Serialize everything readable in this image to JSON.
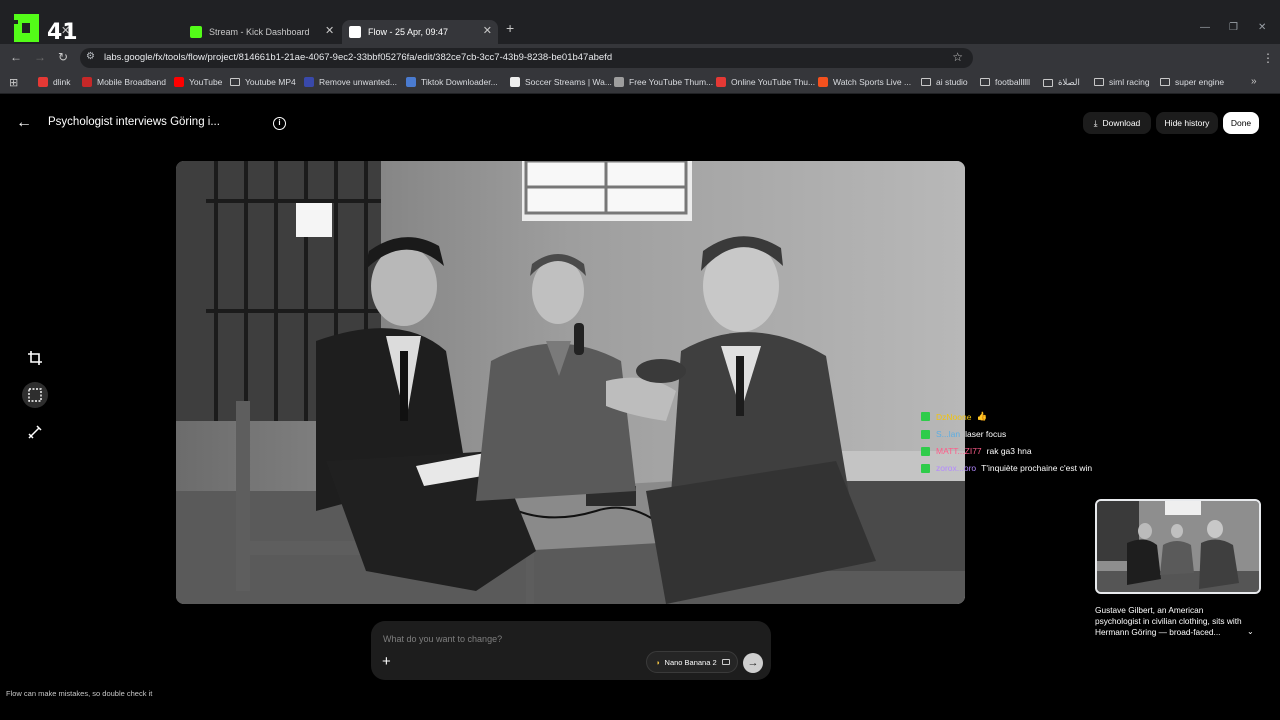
{
  "browser": {
    "logo_text": "41",
    "tabs": [
      {
        "label": "Stream - Kick Dashboard",
        "fav_color": "#53fc18"
      },
      {
        "label": "Flow - 25 Apr, 09:47",
        "fav_color": "#ffffff"
      }
    ],
    "url": "labs.google/fx/tools/flow/project/814661b1-21ae-4067-9ec2-33bbf05276fa/edit/382ce7cb-3cc7-43b9-8238-be01b47abefd",
    "bookmarks": [
      {
        "label": "dlink",
        "type": "site",
        "color": "#e53935"
      },
      {
        "label": "Mobile Broadband",
        "type": "site",
        "color": "#c62828"
      },
      {
        "label": "YouTube",
        "type": "site",
        "color": "#ff0000"
      },
      {
        "label": "Youtube MP4",
        "type": "folder"
      },
      {
        "label": "Remove unwanted...",
        "type": "site",
        "color": "#3949ab"
      },
      {
        "label": "Tiktok Downloader...",
        "type": "site",
        "color": "#4a7bd0"
      },
      {
        "label": "Soccer Streams | Wa...",
        "type": "site",
        "color": "#eeeeee"
      },
      {
        "label": "Free YouTube Thum...",
        "type": "site",
        "color": "#9e9e9e"
      },
      {
        "label": "Online YouTube Thu...",
        "type": "site",
        "color": "#e53935"
      },
      {
        "label": "Watch Sports Live ...",
        "type": "site",
        "color": "#f4511e"
      },
      {
        "label": "ai studio",
        "type": "folder"
      },
      {
        "label": "footballllll",
        "type": "folder"
      },
      {
        "label": "الصلاة",
        "type": "folder"
      },
      {
        "label": "siml racing",
        "type": "folder"
      },
      {
        "label": "super engine",
        "type": "folder"
      }
    ]
  },
  "header": {
    "title": "Psychologist interviews Göring i...",
    "download_label": "Download",
    "hide_history_label": "Hide history",
    "done_label": "Done"
  },
  "chat_overlay": [
    {
      "user": "DzNoone",
      "message": "👍",
      "user_color": "#f1c40f"
    },
    {
      "user": "S...lan",
      "message": "laser focus",
      "user_color": "#5dade2"
    },
    {
      "user": "MATT...ZI77",
      "message": "rak ga3 hna",
      "user_color": "#ff5c8a"
    },
    {
      "user": "zorox...oro",
      "message": "T'inquiète prochaine c'est win",
      "user_color": "#b388ff"
    }
  ],
  "history": {
    "caption": "Gustave Gilbert, an American psychologist in civilian clothing, sits with Hermann Göring — broad-faced..."
  },
  "prompt": {
    "placeholder": "What do you want to change?",
    "model_label": "Nano Banana 2"
  },
  "footer": {
    "disclaimer": "Flow can make mistakes, so double check it"
  }
}
